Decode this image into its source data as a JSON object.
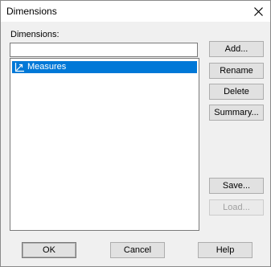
{
  "window": {
    "title": "Dimensions"
  },
  "dialog": {
    "list_label": "Dimensions:",
    "name_input_value": "",
    "items": [
      {
        "label": "Measures",
        "selected": true,
        "icon": "measures-icon"
      }
    ]
  },
  "side_buttons": {
    "add": "Add...",
    "rename": "Rename",
    "delete": "Delete",
    "summary": "Summary...",
    "save": "Save...",
    "load": "Load..."
  },
  "bottom_buttons": {
    "ok": "OK",
    "cancel": "Cancel",
    "help": "Help"
  },
  "colors": {
    "selection": "#0078d7",
    "dialog_bg": "#f0f0f0"
  }
}
